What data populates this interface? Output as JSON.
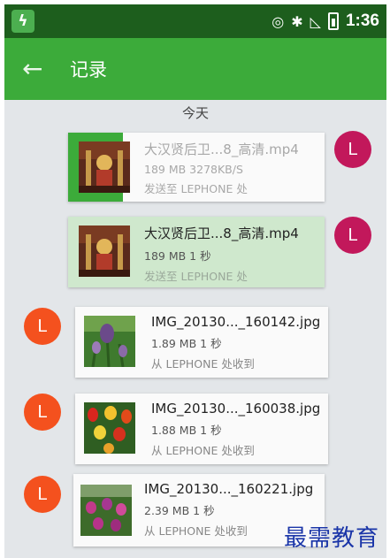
{
  "status_bar": {
    "time": "1:36"
  },
  "app_bar": {
    "title": "记录"
  },
  "date_header": "今天",
  "messages": [
    {
      "avatar": "L",
      "file_name": "大汉贤后卫...8_高清.mp4",
      "meta": "189 MB   3278KB/S",
      "status": "发送至 LEPHONE 处",
      "progress": 0.9
    },
    {
      "avatar": "L",
      "file_name": "大汉贤后卫...8_高清.mp4",
      "meta": "189 MB   1 秒",
      "status": "发送至 LEPHONE 处"
    },
    {
      "avatar": "L",
      "file_name": "IMG_20130..._160142.jpg",
      "meta": "1.89 MB   1 秒",
      "status": "从 LEPHONE 处收到"
    },
    {
      "avatar": "L",
      "file_name": "IMG_20130..._160038.jpg",
      "meta": "1.88 MB   1 秒",
      "status": "从 LEPHONE 处收到"
    },
    {
      "avatar": "L",
      "file_name": "IMG_20130..._160221.jpg",
      "meta": "2.39 MB   1 秒",
      "status": "从 LEPHONE 处收到"
    }
  ],
  "watermark": "最需教育"
}
